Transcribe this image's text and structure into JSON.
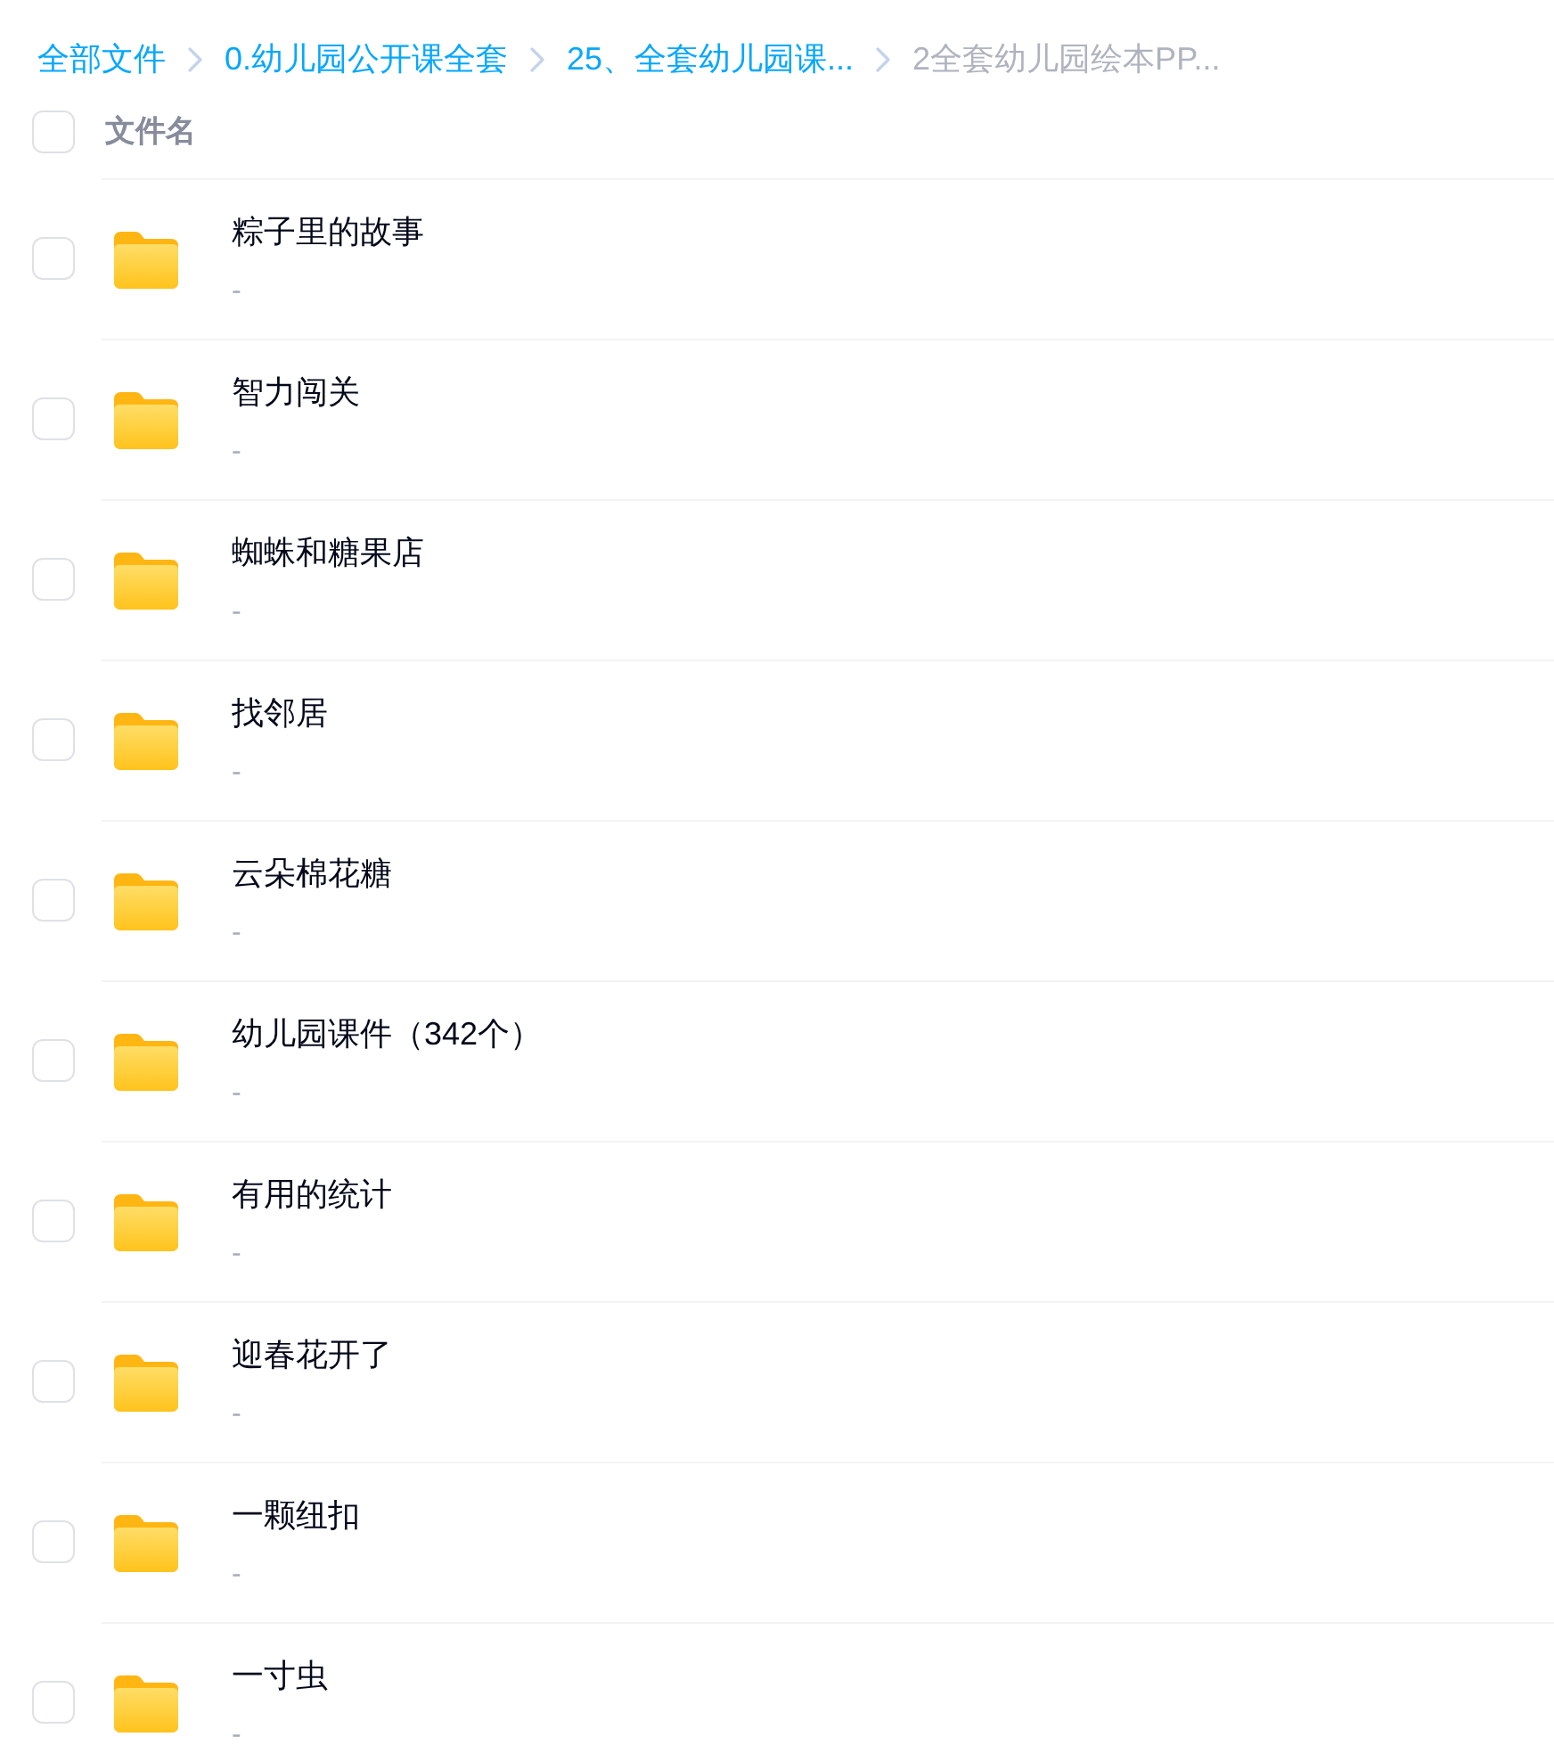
{
  "breadcrumb": [
    {
      "label": "全部文件",
      "current": false
    },
    {
      "label": "0.幼儿园公开课全套",
      "current": false
    },
    {
      "label": "25、全套幼儿园课...",
      "current": false
    },
    {
      "label": "2全套幼儿园绘本PP...",
      "current": true
    }
  ],
  "header": {
    "checked": false,
    "label": "文件名"
  },
  "rows": [
    {
      "name": "粽子里的故事",
      "detail": "-",
      "checked": false
    },
    {
      "name": "智力闯关",
      "detail": "-",
      "checked": false
    },
    {
      "name": "蜘蛛和糖果店",
      "detail": "-",
      "checked": false
    },
    {
      "name": "找邻居",
      "detail": "-",
      "checked": false
    },
    {
      "name": "云朵棉花糖",
      "detail": "-",
      "checked": false
    },
    {
      "name": "幼儿园课件（342个）",
      "detail": "-",
      "checked": false
    },
    {
      "name": "有用的统计",
      "detail": "-",
      "checked": false
    },
    {
      "name": "迎春花开了",
      "detail": "-",
      "checked": false
    },
    {
      "name": "一颗纽扣",
      "detail": "-",
      "checked": false
    },
    {
      "name": "一寸虫",
      "detail": "-",
      "checked": false
    }
  ]
}
